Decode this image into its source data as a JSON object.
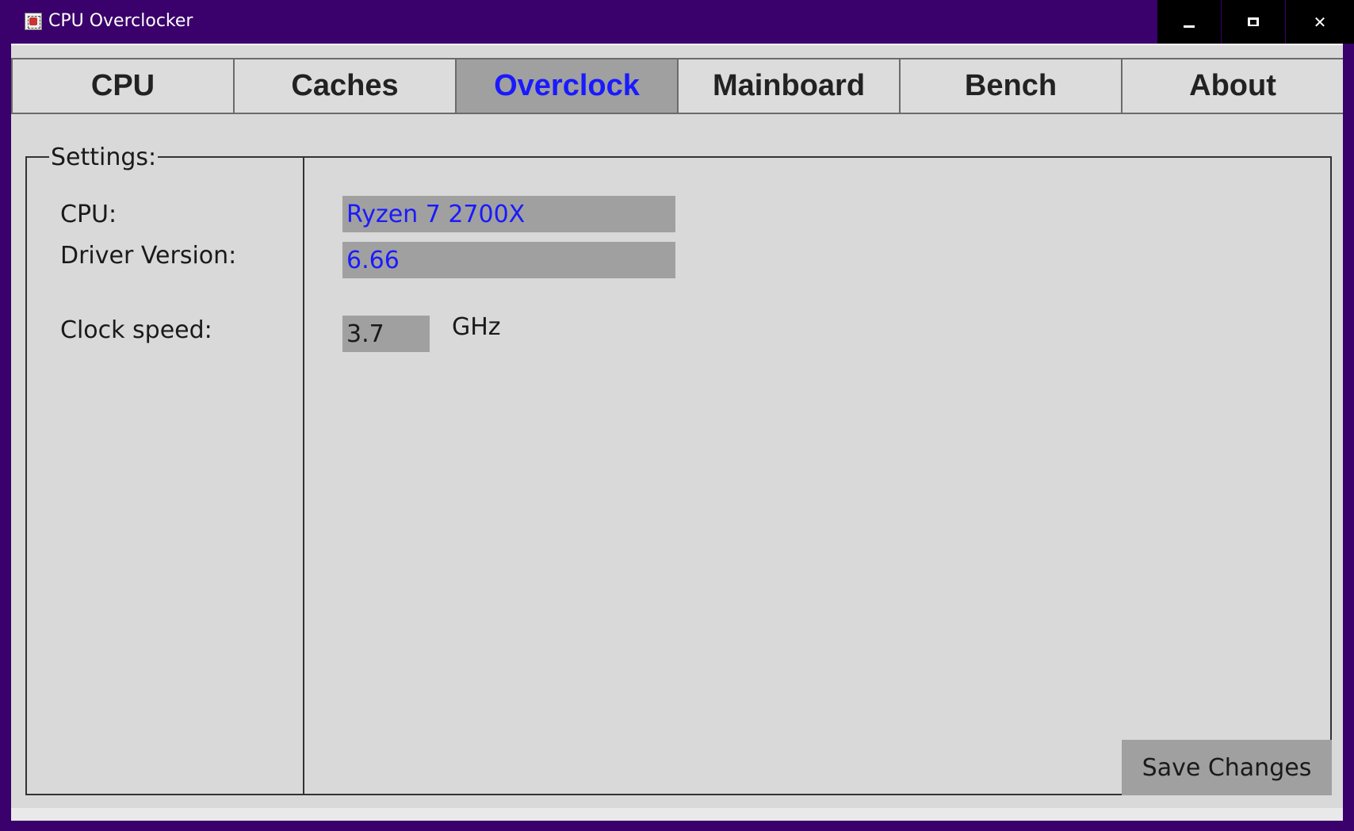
{
  "window": {
    "title": "CPU Overclocker",
    "controls": {
      "minimize_icon": "minimize-icon",
      "maximize_icon": "maximize-icon",
      "close_icon": "close-icon"
    }
  },
  "tabs": [
    {
      "label": "CPU",
      "active": false
    },
    {
      "label": "Caches",
      "active": false
    },
    {
      "label": "Overclock",
      "active": true
    },
    {
      "label": "Mainboard",
      "active": false
    },
    {
      "label": "Bench",
      "active": false
    },
    {
      "label": "About",
      "active": false
    }
  ],
  "settings": {
    "legend": "Settings:",
    "cpu_label": "CPU:",
    "cpu_value": "Ryzen 7 2700X",
    "driver_label": "Driver Version:",
    "driver_value": "6.66",
    "clock_label": "Clock speed:",
    "clock_value": "3.7",
    "clock_unit": "GHz",
    "save_label": "Save Changes"
  },
  "colors": {
    "frame": "#3a006b",
    "client_bg": "#d9d9d9",
    "active_tab_bg": "#a0a0a0",
    "active_tab_text": "#1a1aff",
    "readonly_text": "#1a1aff",
    "field_bg": "#a0a0a0"
  }
}
